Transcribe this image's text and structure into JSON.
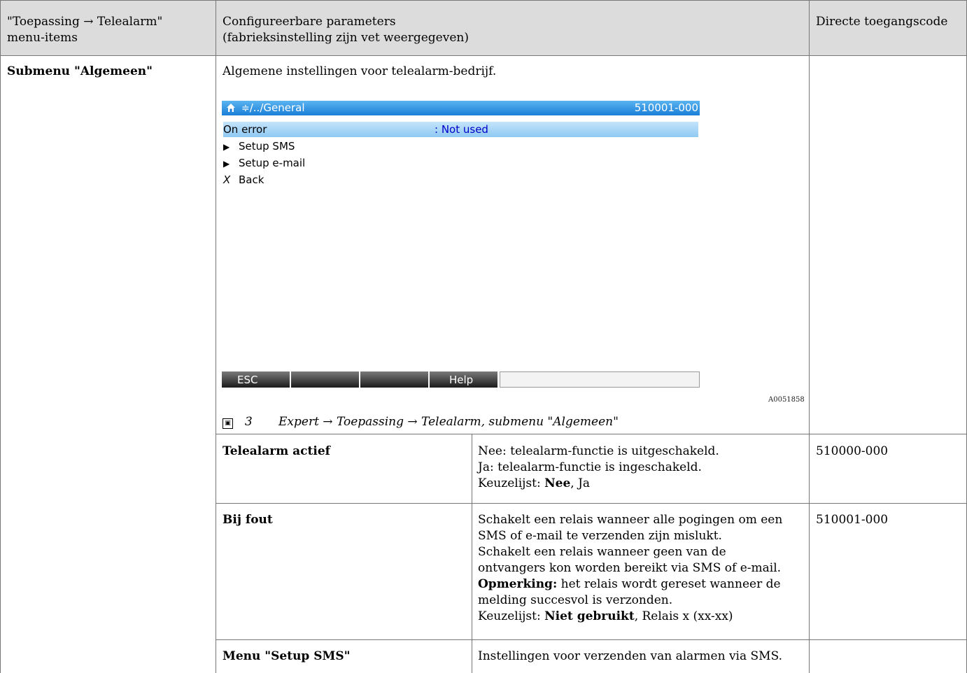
{
  "header": {
    "col1_line1": "\"Toepassing → Telealarm\"",
    "col1_line2": "menu-items",
    "col2_line1": "Configureerbare parameters",
    "col2_line2": "(fabrieksinstelling zijn vet weergegeven)",
    "col3": "Directe toegangscode"
  },
  "submenu": {
    "label": "Submenu \"Algemeen\"",
    "description": "Algemene instellingen voor telealarm-bedrijf."
  },
  "device_screen": {
    "title_path": "/../General",
    "title_code": "510001-000",
    "rows": [
      {
        "label": "On error",
        "value": ": Not used"
      },
      {
        "label": "Setup SMS"
      },
      {
        "label": "Setup e-mail"
      },
      {
        "label": "Back"
      }
    ],
    "softkeys": [
      "ESC",
      "",
      "",
      "Help"
    ],
    "image_code": "A0051858"
  },
  "figure_caption": {
    "number": "3",
    "text": "Expert → Toepassing → Telealarm, submenu \"Algemeen\""
  },
  "rows": [
    {
      "name": "Telealarm actief",
      "desc": [
        "Nee: telealarm-functie is uitgeschakeld.",
        "Ja: telealarm-functie is ingeschakeld."
      ],
      "list_prefix": "Keuzelijst: ",
      "list_bold": "Nee",
      "list_rest": ", Ja",
      "code": "510000-000"
    },
    {
      "name": "Bij fout",
      "desc": [
        "Schakelt een relais wanneer alle pogingen om een",
        "SMS of e-mail te verzenden zijn mislukt.",
        "Schakelt een relais wanneer geen van de",
        "ontvangers kon worden bereikt via SMS of e-mail."
      ],
      "note_bold": "Opmerking:",
      "note_rest": " het relais wordt gereset wanneer de",
      "note_line2": "melding succesvol is verzonden.",
      "list_prefix": "Keuzelijst: ",
      "list_bold": "Niet gebruikt",
      "list_rest": ", Relais x (xx-xx)",
      "code": "510001-000"
    },
    {
      "name": "Menu \"Setup SMS\"",
      "desc": [
        "Instellingen voor verzenden van alarmen via SMS."
      ],
      "code": ""
    }
  ]
}
